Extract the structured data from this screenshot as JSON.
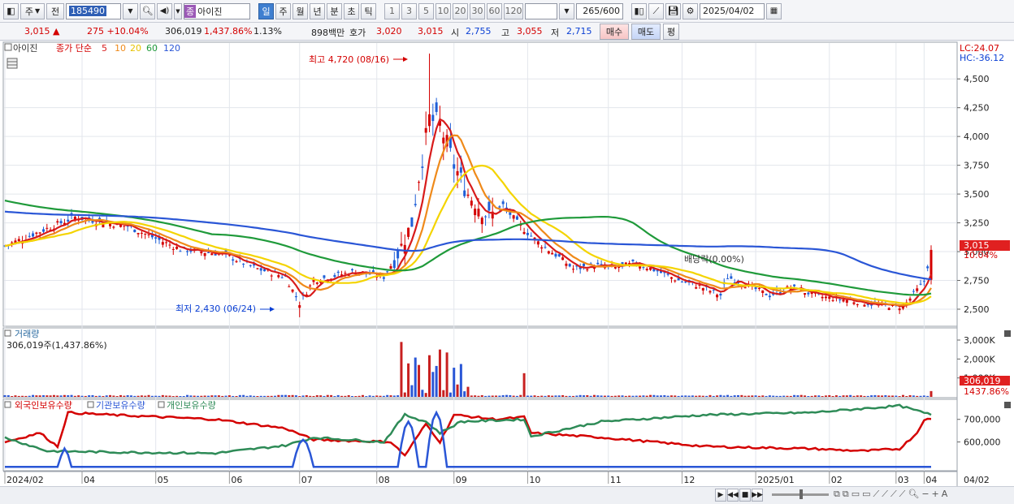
{
  "toolbar": {
    "market": "주",
    "prev_label": "전",
    "code": "185490",
    "stock_name": "아이진",
    "stock_tag": "종",
    "periods": [
      "일",
      "주",
      "월",
      "년",
      "분",
      "초",
      "틱"
    ],
    "active_period": "일",
    "minute_options": [
      "1",
      "3",
      "5",
      "10",
      "20",
      "30",
      "60",
      "120"
    ],
    "count": "265",
    "total": "/600",
    "date": "2025/04/02"
  },
  "quote": {
    "price": "3,015 ▲",
    "change": "275 +10.04%",
    "volume": "306,019",
    "volume_rate": "1,437.86%",
    "turnover_rate": "1.13%",
    "amount": "898백만",
    "hoga_label": "호가",
    "hoga_value": "3,020",
    "hoga_value2": "3,015",
    "open_label": "시",
    "open": "2,755",
    "high_label": "고",
    "high": "3,055",
    "low_label": "저",
    "low": "2,715",
    "buy_label": "매수",
    "sell_label": "매도",
    "avg_label": "평"
  },
  "price_panel": {
    "name": "아이진",
    "ma_label": "종가 단순",
    "ma_periods": [
      {
        "label": "5",
        "color": "#d81b1b"
      },
      {
        "label": "10",
        "color": "#ef8a1a"
      },
      {
        "label": "20",
        "color": "#f4d400"
      },
      {
        "label": "60",
        "color": "#1f9a3a"
      },
      {
        "label": "120",
        "color": "#2a56d6"
      }
    ],
    "high_annot": "최고 4,720 (08/16)",
    "low_annot": "최저 2,430 (06/24)",
    "ex_annot": "배당락(0.00%)",
    "lc": "LC:24.07",
    "hc": "HC:-36.12",
    "yticks": [
      "4,500",
      "4,250",
      "4,000",
      "3,750",
      "3,500",
      "3,250",
      "3,000",
      "2,750",
      "2,500"
    ],
    "last_price": "3,015",
    "last_pct": "10.04%"
  },
  "volume_panel": {
    "title": "거래량",
    "value": "306,019주(1,437.86%)",
    "yticks": [
      "3,000K",
      "2,000K",
      "1,000K"
    ],
    "last_value": "306,019",
    "last_pct": "1437.86%"
  },
  "holding_panel": {
    "legend": [
      {
        "label": "외국인보유수량",
        "color": "#d40000"
      },
      {
        "label": "기관보유수량",
        "color": "#2a56d6"
      },
      {
        "label": "개인보유수량",
        "color": "#2e8b57"
      }
    ],
    "yticks": [
      "700,000",
      "600,000"
    ]
  },
  "xaxis": {
    "labels": [
      "2024/02",
      "04",
      "05",
      "06",
      "07",
      "08",
      "09",
      "10",
      "11",
      "12",
      "2025/01",
      "02",
      "03",
      "04"
    ],
    "right_label": "04/02"
  },
  "chart_data": {
    "type": "candlestick",
    "title": "아이진",
    "price_ylim": [
      2380,
      4720
    ],
    "high": 4720,
    "low": 2430,
    "last": 3015,
    "volume_ylim": [
      0,
      3300000
    ],
    "holding_ylim": [
      480000,
      760000
    ]
  }
}
